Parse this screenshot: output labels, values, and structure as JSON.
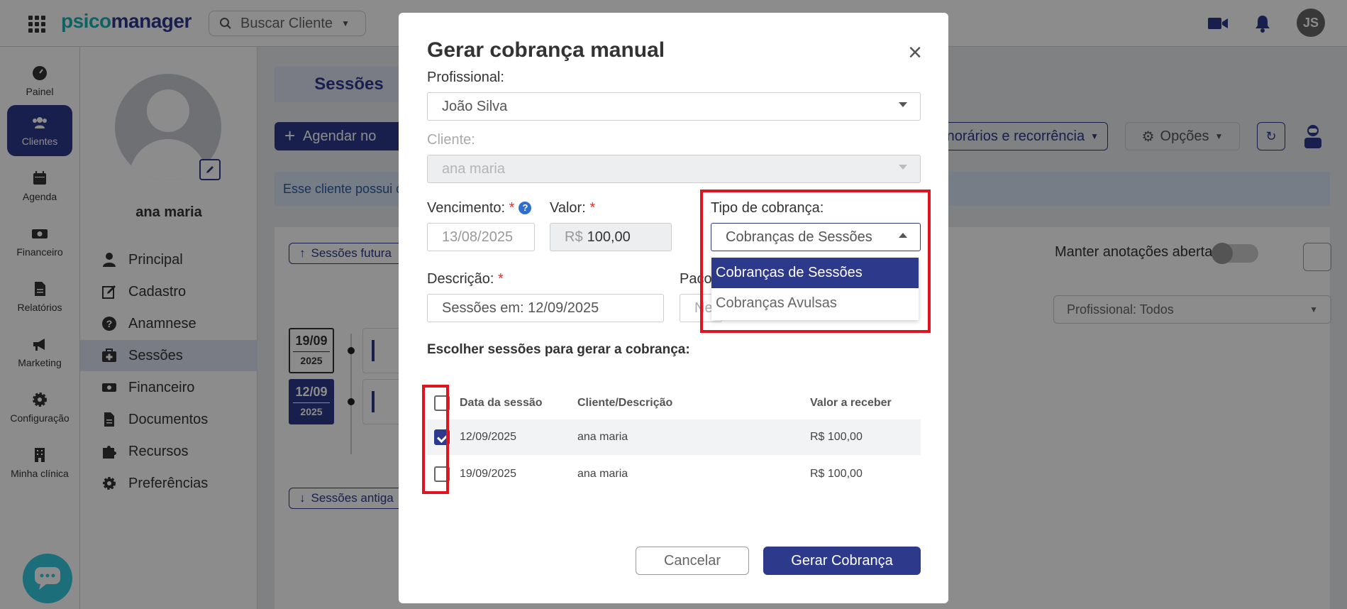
{
  "topbar": {
    "logo_part1": "psico",
    "logo_part2": "manager",
    "search_placeholder": "Buscar Cliente",
    "avatar_initials": "JS"
  },
  "leftnav": [
    {
      "label": "Painel",
      "icon": "dashboard-icon"
    },
    {
      "label": "Clientes",
      "icon": "users-icon",
      "active": true
    },
    {
      "label": "Agenda",
      "icon": "calendar-icon"
    },
    {
      "label": "Financeiro",
      "icon": "money-icon"
    },
    {
      "label": "Relatórios",
      "icon": "file-icon"
    },
    {
      "label": "Marketing",
      "icon": "megaphone-icon"
    },
    {
      "label": "Configuração",
      "icon": "gear-icon"
    },
    {
      "label": "Minha clínica",
      "icon": "building-icon"
    }
  ],
  "profile": {
    "name": "ana maria",
    "menu": [
      {
        "label": "Principal"
      },
      {
        "label": "Cadastro"
      },
      {
        "label": "Anamnese"
      },
      {
        "label": "Sessões",
        "active": true
      },
      {
        "label": "Financeiro"
      },
      {
        "label": "Documentos"
      },
      {
        "label": "Recursos"
      },
      {
        "label": "Preferências"
      }
    ]
  },
  "main": {
    "tab_title": "Sessões",
    "agendar_label": "Agendar no",
    "honorarios_label": "norários e recorrência",
    "opcoes_label": "Opções",
    "banner_text": "Esse cliente possui c",
    "futuras_label": "Sessões futura",
    "antigas_label": "Sessões antiga",
    "dates": [
      {
        "day": "19/09",
        "year": "2025"
      },
      {
        "day": "12/09",
        "year": "2025",
        "active": true
      }
    ],
    "manter_label": "Manter anotações abertas",
    "profissional_filter": "Profissional: Todos"
  },
  "modal": {
    "title": "Gerar cobrança manual",
    "profissional_label": "Profissional:",
    "profissional_value": "João Silva",
    "cliente_label": "Cliente:",
    "cliente_value": "ana maria",
    "vencimento_label": "Vencimento:",
    "vencimento_value": "13/08/2025",
    "valor_label": "Valor:",
    "valor_currency": "R$",
    "valor_value": "100,00",
    "tipo_label": "Tipo de cobrança:",
    "tipo_value": "Cobranças de Sessões",
    "tipo_options": [
      "Cobranças de Sessões",
      "Cobranças Avulsas"
    ],
    "descricao_label": "Descrição:",
    "descricao_value": "Sessões em: 12/09/2025",
    "pacote_label": "Paco",
    "pacote_value": "Ne",
    "required_mark": "*",
    "section_title": "Escolher sessões para gerar a cobrança:",
    "table": {
      "headers": [
        "Data da sessão",
        "Cliente/Descrição",
        "Valor a receber"
      ],
      "rows": [
        {
          "date": "12/09/2025",
          "client": "ana maria",
          "value": "R$ 100,00",
          "checked": true
        },
        {
          "date": "19/09/2025",
          "client": "ana maria",
          "value": "R$ 100,00",
          "checked": false
        }
      ]
    },
    "cancel_label": "Cancelar",
    "submit_label": "Gerar Cobrança"
  },
  "colors": {
    "primary": "#2d3a8c",
    "teal": "#1bb3b3",
    "highlight_red": "#e0141e"
  }
}
